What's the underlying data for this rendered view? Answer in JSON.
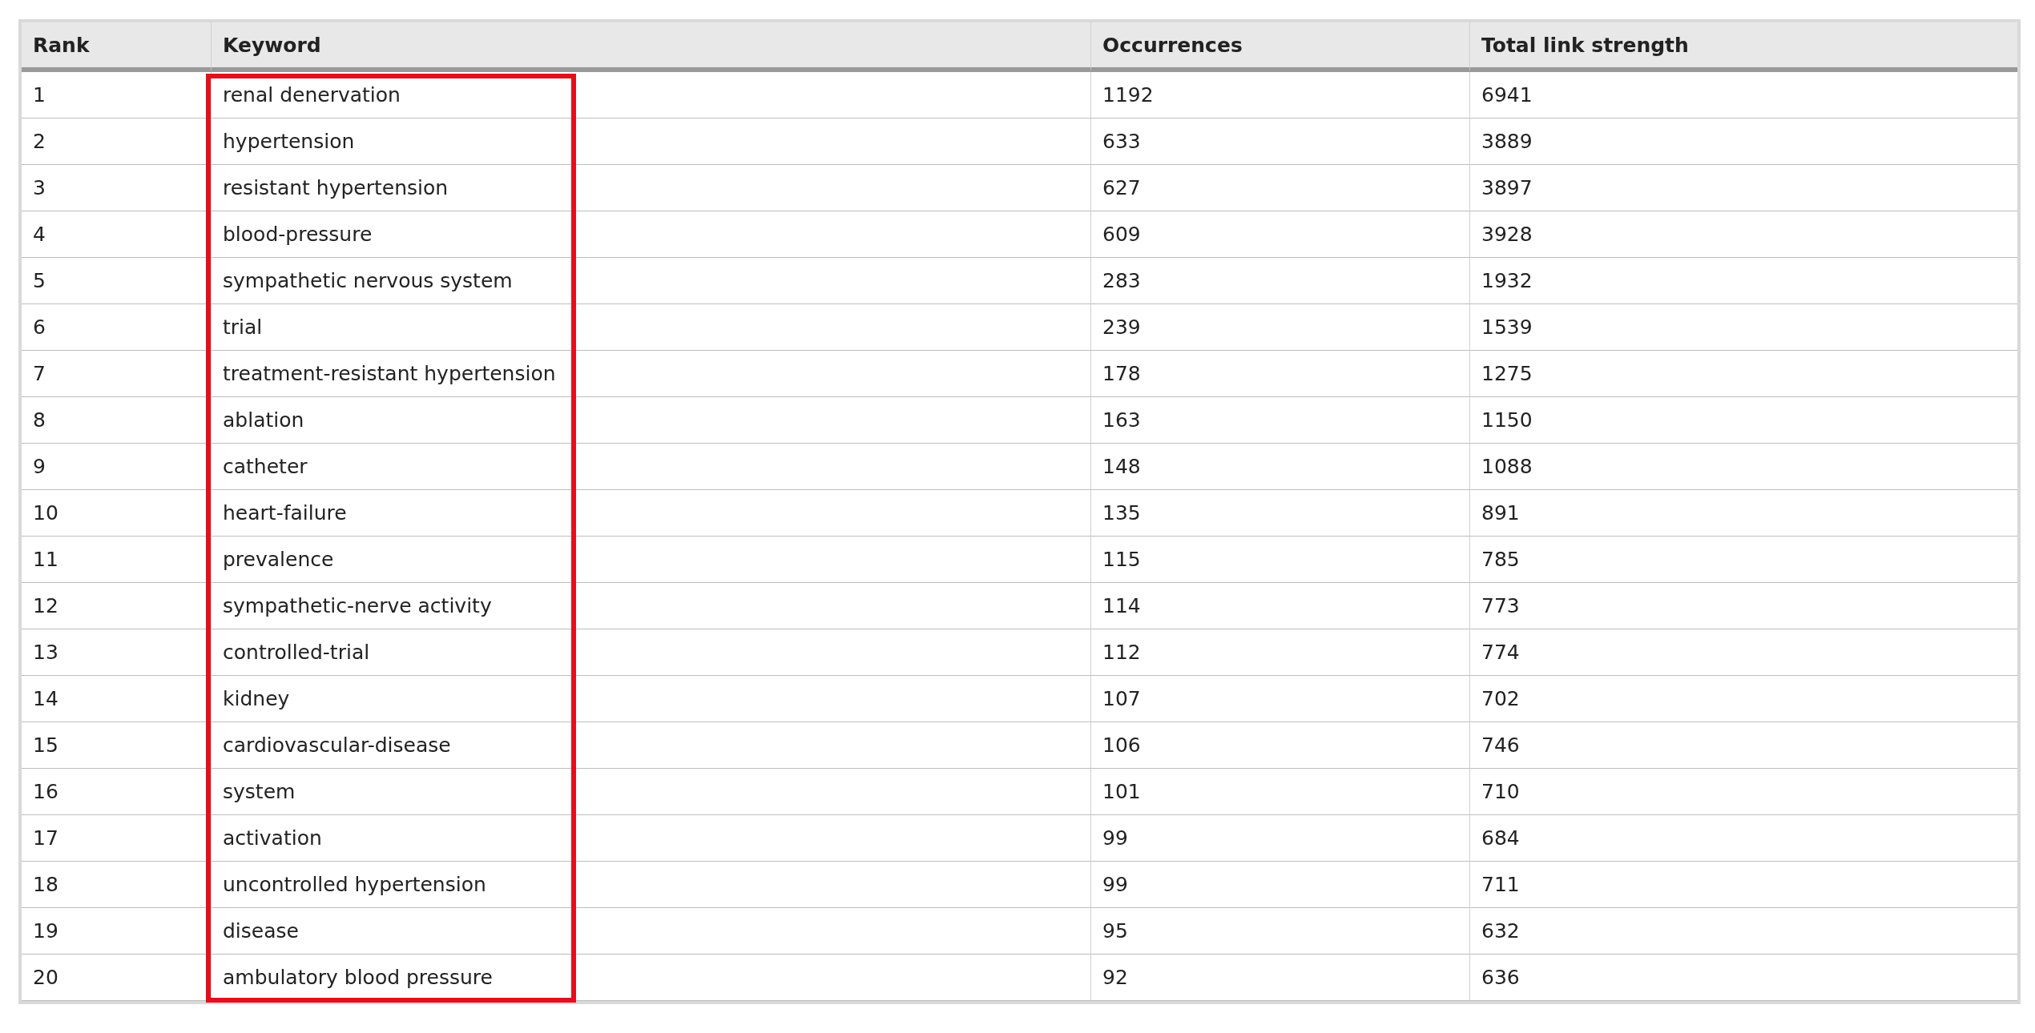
{
  "table": {
    "columns": [
      {
        "label": "Rank",
        "highlighted": false
      },
      {
        "label": "Keyword",
        "highlighted": true
      },
      {
        "label": "Occurrences",
        "highlighted": false
      },
      {
        "label": "Total link strength",
        "highlighted": false
      }
    ],
    "rows": [
      [
        "1",
        "renal denervation",
        "1192",
        "6941"
      ],
      [
        "2",
        "hypertension",
        "633",
        "3889"
      ],
      [
        "3",
        "resistant hypertension",
        "627",
        "3897"
      ],
      [
        "4",
        "blood-pressure",
        "609",
        "3928"
      ],
      [
        "5",
        "sympathetic nervous system",
        "283",
        "1932"
      ],
      [
        "6",
        "trial",
        "239",
        "1539"
      ],
      [
        "7",
        "treatment-resistant hypertension",
        "178",
        "1275"
      ],
      [
        "8",
        "ablation",
        "163",
        "1150"
      ],
      [
        "9",
        "catheter",
        "148",
        "1088"
      ],
      [
        "10",
        "heart-failure",
        "135",
        "891"
      ],
      [
        "11",
        "prevalence",
        "115",
        "785"
      ],
      [
        "12",
        "sympathetic-nerve activity",
        "114",
        "773"
      ],
      [
        "13",
        "controlled-trial",
        "112",
        "774"
      ],
      [
        "14",
        "kidney",
        "107",
        "702"
      ],
      [
        "15",
        "cardiovascular-disease",
        "106",
        "746"
      ],
      [
        "16",
        "system",
        "101",
        "710"
      ],
      [
        "17",
        "activation",
        "99",
        "684"
      ],
      [
        "18",
        "uncontrolled hypertension",
        "99",
        "711"
      ],
      [
        "19",
        "disease",
        "95",
        "632"
      ],
      [
        "20",
        "ambulatory blood pressure",
        "92",
        "636"
      ]
    ]
  }
}
